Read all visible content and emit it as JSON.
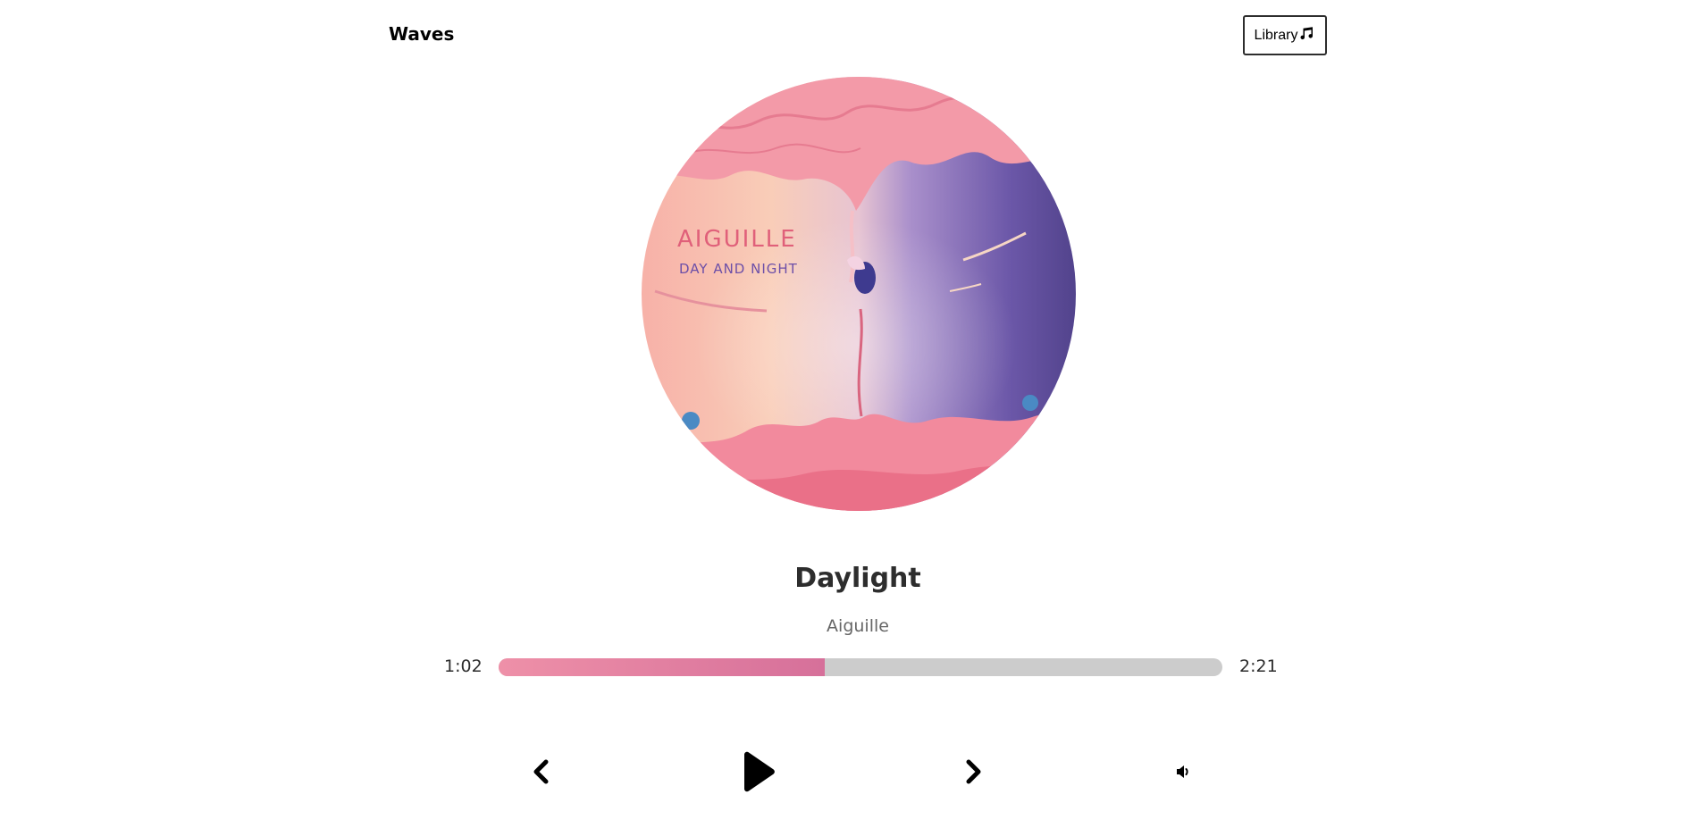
{
  "nav": {
    "brand": "Waves",
    "library_label": "Library",
    "library_icon": "music-note-icon"
  },
  "album": {
    "cover_icon": "album-cover-image",
    "cover_text_artist": "AIGUILLE",
    "cover_text_album": "DAY AND NIGHT"
  },
  "song": {
    "title": "Daylight",
    "artist": "Aiguille"
  },
  "progress": {
    "current_time": "1:02",
    "total_time": "2:21",
    "fraction": 0.45
  },
  "controls": {
    "prev_icon": "chevron-left-icon",
    "play_icon": "play-icon",
    "next_icon": "chevron-right-icon",
    "volume_icon": "volume-icon"
  },
  "colors": {
    "progress_start": "#ee90a8",
    "progress_end": "#d6709a",
    "track": "#cccccc"
  }
}
